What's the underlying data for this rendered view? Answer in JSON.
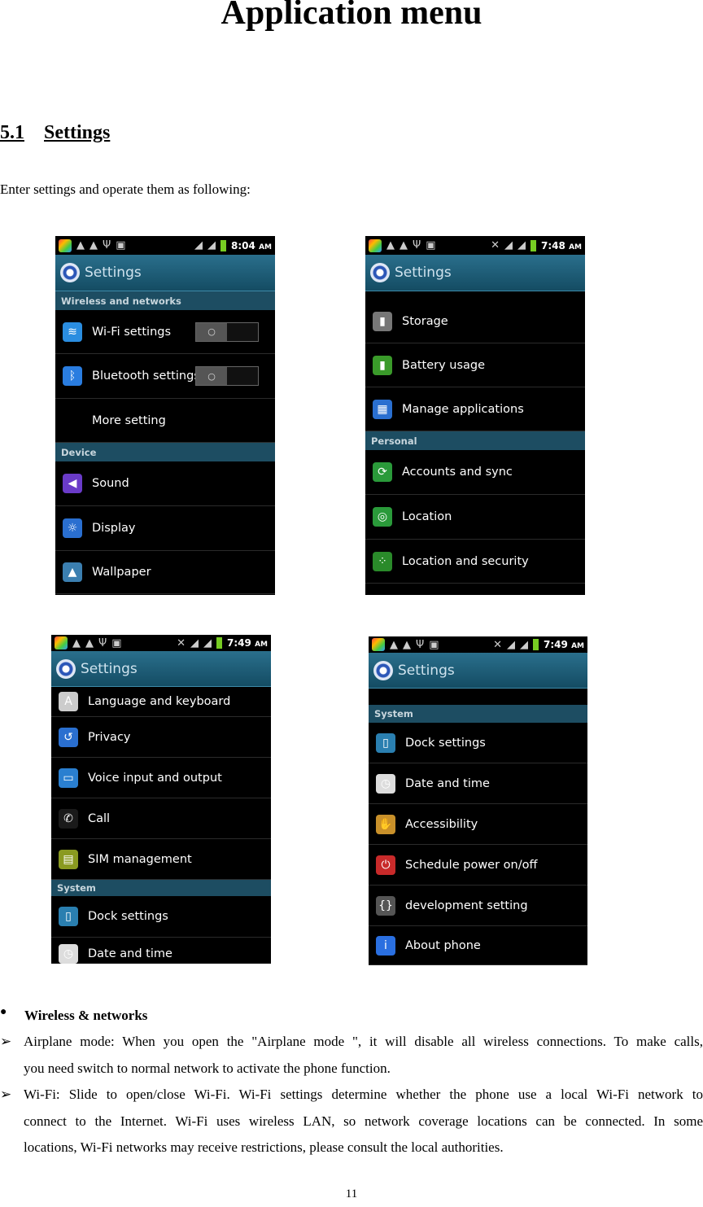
{
  "page_title": "Application menu",
  "section": {
    "number": "5.1",
    "title": "Settings"
  },
  "intro": "Enter settings and operate them as following:",
  "phones": [
    {
      "time": "8:04",
      "ampm": "AM",
      "header": "Settings",
      "rows": [
        {
          "type": "section",
          "label": "Wireless and networks"
        },
        {
          "type": "item",
          "label": "Wi-Fi settings",
          "icon": "wifi-icon",
          "color": "#2a8de0",
          "glyph": "≋",
          "toggle": "off"
        },
        {
          "type": "item",
          "label": "Bluetooth settings",
          "icon": "bluetooth-icon",
          "color": "#2a7de0",
          "glyph": "ᛒ",
          "toggle": "off"
        },
        {
          "type": "item",
          "label": "More setting",
          "icon": "",
          "color": "",
          "glyph": ""
        },
        {
          "type": "section",
          "label": "Device"
        },
        {
          "type": "item",
          "label": "Sound",
          "icon": "speaker-icon",
          "color": "#6a3bc8",
          "glyph": "◀"
        },
        {
          "type": "item",
          "label": "Display",
          "icon": "brightness-icon",
          "color": "#2a6fd0",
          "glyph": "☼"
        },
        {
          "type": "item",
          "label": "Wallpaper",
          "icon": "wallpaper-icon",
          "color": "#3b7fb0",
          "glyph": "▲"
        }
      ]
    },
    {
      "time": "7:48",
      "ampm": "AM",
      "header": "Settings",
      "rows": [
        {
          "type": "blank"
        },
        {
          "type": "item",
          "label": "Storage",
          "icon": "sd-card-icon",
          "color": "#777",
          "glyph": "▮"
        },
        {
          "type": "item",
          "label": "Battery usage",
          "icon": "battery-icon",
          "color": "#3a9a2a",
          "glyph": "▮"
        },
        {
          "type": "item",
          "label": "Manage applications",
          "icon": "apps-icon",
          "color": "#2a6fd0",
          "glyph": "▦"
        },
        {
          "type": "section",
          "label": "Personal"
        },
        {
          "type": "item",
          "label": "Accounts and sync",
          "icon": "sync-icon",
          "color": "#2a9a3a",
          "glyph": "⟳"
        },
        {
          "type": "item",
          "label": "Location",
          "icon": "location-icon",
          "color": "#2a9a3a",
          "glyph": "◎"
        },
        {
          "type": "item",
          "label": "Location and security",
          "icon": "security-pattern-icon",
          "color": "#2a8a2a",
          "glyph": "⁘"
        },
        {
          "type": "blank"
        }
      ]
    },
    {
      "time": "7:49",
      "ampm": "AM",
      "header": "Settings",
      "rows": [
        {
          "type": "item",
          "label": "Language and keyboard",
          "icon": "keyboard-icon",
          "color": "#ccc",
          "glyph": "A"
        },
        {
          "type": "item",
          "label": "Privacy",
          "icon": "privacy-icon",
          "color": "#2a6fd0",
          "glyph": "↺"
        },
        {
          "type": "item",
          "label": "Voice input and output",
          "icon": "voice-icon",
          "color": "#2a7fd0",
          "glyph": "▭"
        },
        {
          "type": "item",
          "label": "Call",
          "icon": "phone-icon",
          "color": "#1a1a1a",
          "glyph": "✆"
        },
        {
          "type": "item",
          "label": "SIM management",
          "icon": "sim-icon",
          "color": "#8a9a20",
          "glyph": "▤"
        },
        {
          "type": "section",
          "label": "System"
        },
        {
          "type": "item",
          "label": "Dock settings",
          "icon": "dock-icon",
          "color": "#2a7fb0",
          "glyph": "▯"
        },
        {
          "type": "item",
          "label": "Date and time",
          "icon": "clock-icon",
          "color": "#ddd",
          "glyph": "◷"
        }
      ]
    },
    {
      "time": "7:49",
      "ampm": "AM",
      "header": "Settings",
      "rows": [
        {
          "type": "blank"
        },
        {
          "type": "section",
          "label": "System"
        },
        {
          "type": "item",
          "label": "Dock settings",
          "icon": "dock-icon",
          "color": "#2a7fb0",
          "glyph": "▯"
        },
        {
          "type": "item",
          "label": "Date and time",
          "icon": "clock-icon",
          "color": "#ddd",
          "glyph": "◷"
        },
        {
          "type": "item",
          "label": "Accessibility",
          "icon": "hand-icon",
          "color": "#c8902a",
          "glyph": "✋"
        },
        {
          "type": "item",
          "label": "Schedule power on/off",
          "icon": "power-schedule-icon",
          "color": "#c82a2a",
          "glyph": "⏻"
        },
        {
          "type": "item",
          "label": "development setting",
          "icon": "braces-icon",
          "color": "#555",
          "glyph": "{}"
        },
        {
          "type": "item",
          "label": "About phone",
          "icon": "info-icon",
          "color": "#2a6fe0",
          "glyph": "i"
        }
      ]
    }
  ],
  "bullets": {
    "heading": "Wireless & networks",
    "items": [
      {
        "line1": "Airplane mode: When you open the \"Airplane mode \", it will disable all wireless connections. To make calls,",
        "line2": "you need switch to normal network to activate the phone function."
      },
      {
        "line1": "Wi-Fi: Slide to open/close Wi-Fi. Wi-Fi settings determine whether the phone use a local Wi-Fi network to",
        "line2": "connect to the Internet. Wi-Fi uses wireless LAN, so network coverage locations can be connected. In some",
        "line3": "locations, Wi-Fi networks may receive restrictions, please consult the local authorities."
      }
    ]
  },
  "page_number": "11"
}
